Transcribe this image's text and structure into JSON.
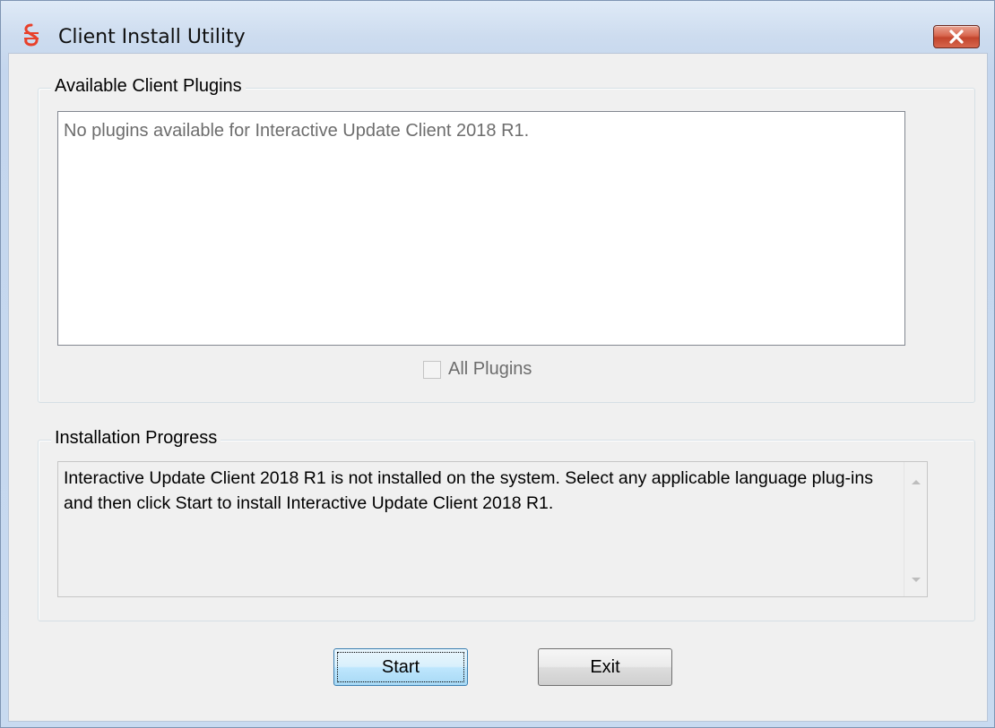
{
  "window": {
    "title": "Client Install Utility",
    "icon": "app-icon",
    "close_icon": "close-icon"
  },
  "plugins_group": {
    "legend": "Available Client Plugins",
    "list_message": "No plugins available for Interactive Update Client 2018 R1.",
    "all_plugins_label": "All Plugins",
    "all_plugins_checked": false,
    "all_plugins_enabled": false
  },
  "progress_group": {
    "legend": "Installation Progress",
    "message": "Interactive Update Client 2018 R1 is not installed on the system. Select any applicable language plug-ins and then click Start to install Interactive Update Client 2018 R1."
  },
  "buttons": {
    "start_label": "Start",
    "exit_label": "Exit"
  },
  "colors": {
    "close_button": "#c8472f",
    "default_button_border": "#3c7fb1",
    "icon_accent": "#e8402a"
  }
}
